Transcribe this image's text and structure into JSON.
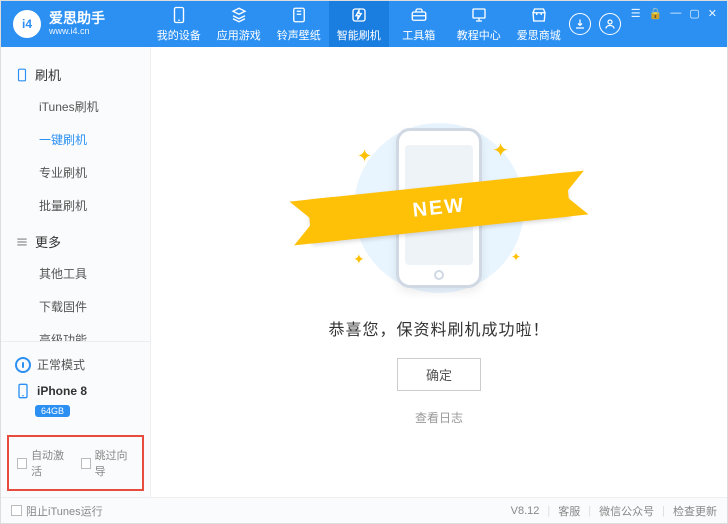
{
  "brand": {
    "logo_text": "i4",
    "title": "爱思助手",
    "url": "www.i4.cn"
  },
  "nav": [
    {
      "icon": "phone",
      "label": "我的设备"
    },
    {
      "icon": "apps",
      "label": "应用游戏"
    },
    {
      "icon": "ringtone",
      "label": "铃声壁纸"
    },
    {
      "icon": "flash",
      "label": "智能刷机",
      "active": true
    },
    {
      "icon": "toolbox",
      "label": "工具箱"
    },
    {
      "icon": "tutorial",
      "label": "教程中心"
    },
    {
      "icon": "store",
      "label": "爱思商城"
    }
  ],
  "sidebar": {
    "sections": [
      {
        "title": "刷机",
        "icon": "phone-v",
        "items": [
          {
            "label": "iTunes刷机"
          },
          {
            "label": "一键刷机",
            "active": true
          },
          {
            "label": "专业刷机"
          },
          {
            "label": "批量刷机"
          }
        ]
      },
      {
        "title": "更多",
        "icon": "more",
        "items": [
          {
            "label": "其他工具"
          },
          {
            "label": "下载固件"
          },
          {
            "label": "高级功能"
          }
        ]
      }
    ],
    "device": {
      "mode": "正常模式",
      "model": "iPhone 8",
      "storage": "64GB"
    },
    "options": [
      {
        "label": "自动激活"
      },
      {
        "label": "跳过向导"
      }
    ]
  },
  "main": {
    "ribbon": "NEW",
    "message": "恭喜您，保资料刷机成功啦！",
    "ok": "确定",
    "log": "查看日志"
  },
  "statusbar": {
    "block_itunes": "阻止iTunes运行",
    "version": "V8.12",
    "support": "客服",
    "wechat": "微信公众号",
    "update": "检查更新"
  }
}
